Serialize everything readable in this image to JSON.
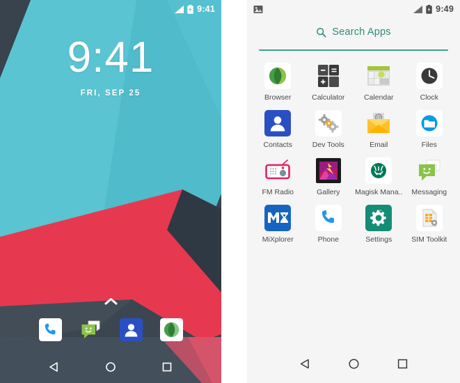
{
  "left_phone": {
    "name": "android-lock-home-screen",
    "status_bar": {
      "time": "9:41",
      "signal_icon": "signal-bars-icon",
      "battery_icon": "battery-charging-icon"
    },
    "clock": {
      "time": "9:41",
      "date": "FRI, SEP 25"
    },
    "drawer_handle_icon": "chevron-up-icon",
    "wallpaper": {
      "teal": "#5BC4D2",
      "teal_light": "#66CAD6",
      "teal_dark": "#49B3C4",
      "red": "#E63950",
      "red_dark": "#D12E46",
      "navy": "#3C4650",
      "navy_light": "#47525E"
    },
    "dock": [
      {
        "label": "Phone",
        "icon": "phone-icon"
      },
      {
        "label": "Messaging",
        "icon": "messaging-icon"
      },
      {
        "label": "Contacts",
        "icon": "contacts-icon"
      },
      {
        "label": "Browser",
        "icon": "browser-icon"
      }
    ],
    "nav": [
      {
        "label": "Back",
        "icon": "back-triangle-icon"
      },
      {
        "label": "Home",
        "icon": "home-circle-icon"
      },
      {
        "label": "Recents",
        "icon": "recents-square-icon"
      }
    ]
  },
  "right_phone": {
    "name": "android-app-drawer",
    "status_bar": {
      "time": "9:49",
      "notification_icon": "image-notification-icon",
      "signal_icon": "signal-bars-icon",
      "battery_icon": "battery-charging-icon"
    },
    "search": {
      "label": "Search Apps",
      "icon": "search-icon",
      "accent": "#2E8B7A",
      "underline_color": "#3FA08C"
    },
    "background": "#F5F5F5",
    "apps": [
      {
        "label": "Browser",
        "icon": "browser-icon"
      },
      {
        "label": "Calculator",
        "icon": "calculator-icon"
      },
      {
        "label": "Calendar",
        "icon": "calendar-icon"
      },
      {
        "label": "Clock",
        "icon": "clock-icon"
      },
      {
        "label": "Contacts",
        "icon": "contacts-icon"
      },
      {
        "label": "Dev Tools",
        "icon": "dev-tools-icon"
      },
      {
        "label": "Email",
        "icon": "email-icon"
      },
      {
        "label": "Files",
        "icon": "files-icon"
      },
      {
        "label": "FM Radio",
        "icon": "fm-radio-icon"
      },
      {
        "label": "Gallery",
        "icon": "gallery-icon"
      },
      {
        "label": "Magisk Mana..",
        "icon": "magisk-manager-icon"
      },
      {
        "label": "Messaging",
        "icon": "messaging-icon"
      },
      {
        "label": "MiXplorer",
        "icon": "mixplorer-icon"
      },
      {
        "label": "Phone",
        "icon": "phone-icon"
      },
      {
        "label": "Settings",
        "icon": "settings-icon"
      },
      {
        "label": "SIM Toolkit",
        "icon": "sim-toolkit-icon"
      }
    ],
    "nav": [
      {
        "label": "Back",
        "icon": "back-triangle-icon"
      },
      {
        "label": "Home",
        "icon": "home-circle-icon"
      },
      {
        "label": "Recents",
        "icon": "recents-square-icon"
      }
    ]
  }
}
